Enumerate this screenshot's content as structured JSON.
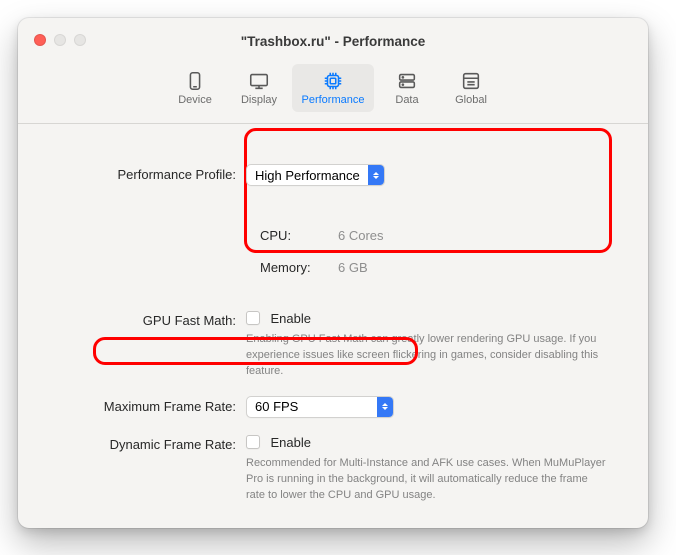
{
  "title": "\"Trashbox.ru\" - Performance",
  "tabs": {
    "device": "Device",
    "display": "Display",
    "performance": "Performance",
    "data": "Data",
    "global": "Global"
  },
  "labels": {
    "profile": "Performance Profile:",
    "gpu": "GPU Fast Math:",
    "maxfps": "Maximum Frame Rate:",
    "dynfps": "Dynamic Frame Rate:"
  },
  "profile_value": "High Performance",
  "specs": {
    "cpu_k": "CPU:",
    "cpu_v": "6 Cores",
    "mem_k": "Memory:",
    "mem_v": "6 GB"
  },
  "enable": "Enable",
  "gpu_help": "Enabling GPU Fast Math can greatly lower rendering GPU usage. If you experience issues like screen flickering in games, consider disabling this feature.",
  "fps_value": "60 FPS",
  "dyn_help": "Recommended for Multi-Instance and AFK use cases. When MuMuPlayer Pro is running in the background, it will automatically reduce the frame rate to lower the CPU and GPU usage."
}
